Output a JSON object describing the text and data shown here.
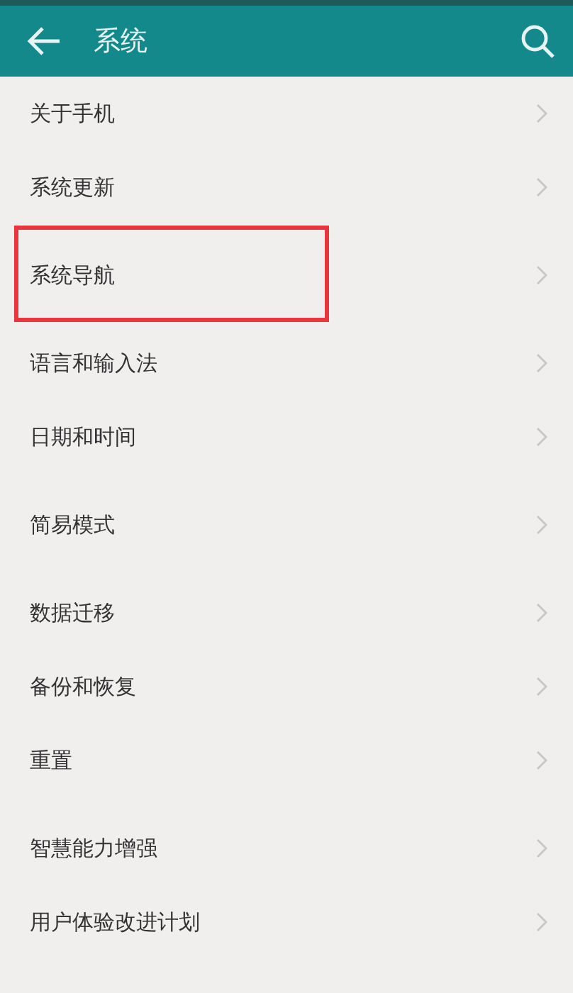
{
  "header": {
    "title": "系统"
  },
  "groups": [
    {
      "items": [
        {
          "label": "关于手机",
          "highlighted": false
        },
        {
          "label": "系统更新",
          "highlighted": false
        }
      ]
    },
    {
      "items": [
        {
          "label": "系统导航",
          "highlighted": true
        }
      ]
    },
    {
      "items": [
        {
          "label": "语言和输入法",
          "highlighted": false
        },
        {
          "label": "日期和时间",
          "highlighted": false
        }
      ]
    },
    {
      "items": [
        {
          "label": "简易模式",
          "highlighted": false
        }
      ]
    },
    {
      "items": [
        {
          "label": "数据迁移",
          "highlighted": false
        },
        {
          "label": "备份和恢复",
          "highlighted": false
        },
        {
          "label": "重置",
          "highlighted": false
        }
      ]
    },
    {
      "items": [
        {
          "label": "智慧能力增强",
          "highlighted": false
        },
        {
          "label": "用户体验改进计划",
          "highlighted": false
        }
      ]
    }
  ]
}
